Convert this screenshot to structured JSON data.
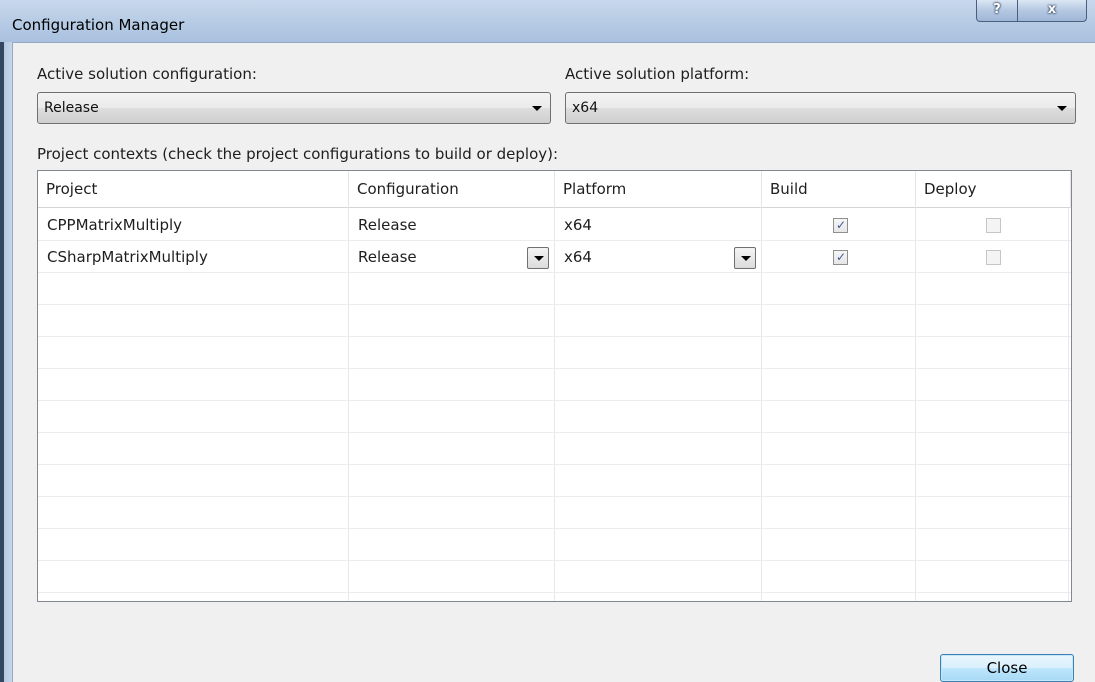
{
  "window": {
    "title": "Configuration Manager",
    "help_button": "?",
    "close_button": "x"
  },
  "solution_config": {
    "label": "Active solution configuration:",
    "value": "Release"
  },
  "solution_platform": {
    "label": "Active solution platform:",
    "value": "x64"
  },
  "project_contexts_label": "Project contexts (check the project configurations to build or deploy):",
  "grid": {
    "columns": [
      "Project",
      "Configuration",
      "Platform",
      "Build",
      "Deploy"
    ],
    "rows": [
      {
        "project": "CPPMatrixMultiply",
        "configuration": "Release",
        "platform": "x64",
        "build": true,
        "deploy": false
      },
      {
        "project": "CSharpMatrixMultiply",
        "configuration": "Release",
        "platform": "x64",
        "build": true,
        "deploy": false
      }
    ]
  },
  "close_label": "Close"
}
